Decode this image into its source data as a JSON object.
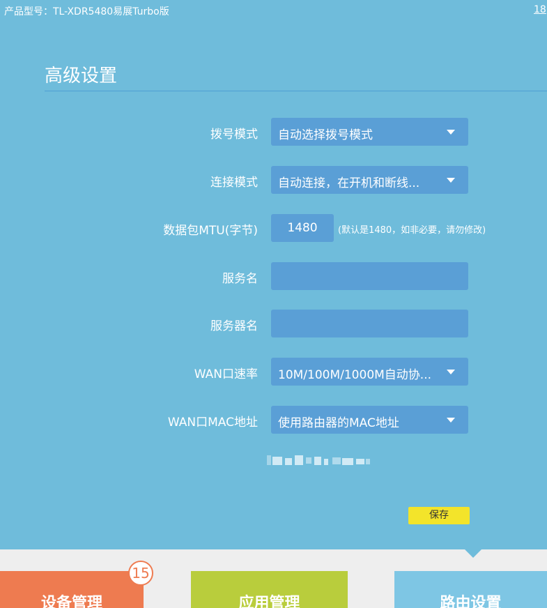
{
  "header": {
    "model_text": "产品型号：TL-XDR5480易展Turbo版",
    "top_right_link": "18"
  },
  "page": {
    "title": "高级设置"
  },
  "form": {
    "dial_mode": {
      "label": "拨号模式",
      "value": "自动选择拨号模式"
    },
    "connect_mode": {
      "label": "连接模式",
      "value": "自动连接，在开机和断线..."
    },
    "mtu": {
      "label": "数据包MTU(字节)",
      "value": "1480",
      "hint": "(默认是1480，如非必要，请勿修改)"
    },
    "service_name": {
      "label": "服务名",
      "value": ""
    },
    "server_name": {
      "label": "服务器名",
      "value": ""
    },
    "wan_speed": {
      "label": "WAN口速率",
      "value": "10M/100M/1000M自动协..."
    },
    "wan_mac": {
      "label": "WAN口MAC地址",
      "value": "使用路由器的MAC地址"
    }
  },
  "save_label": "保存",
  "bottom_nav": {
    "device_mgmt": {
      "label": "设备管理",
      "badge": "15"
    },
    "app_mgmt": {
      "label": "应用管理"
    },
    "router_settings": {
      "label": "路由设置"
    }
  },
  "colors": {
    "background": "#6fbcdb",
    "field": "#5a9fd6",
    "save_button": "#f3e42a",
    "tile_device": "#ee7b50",
    "tile_app": "#b9cd3c",
    "tile_router": "#7ec6e4"
  }
}
